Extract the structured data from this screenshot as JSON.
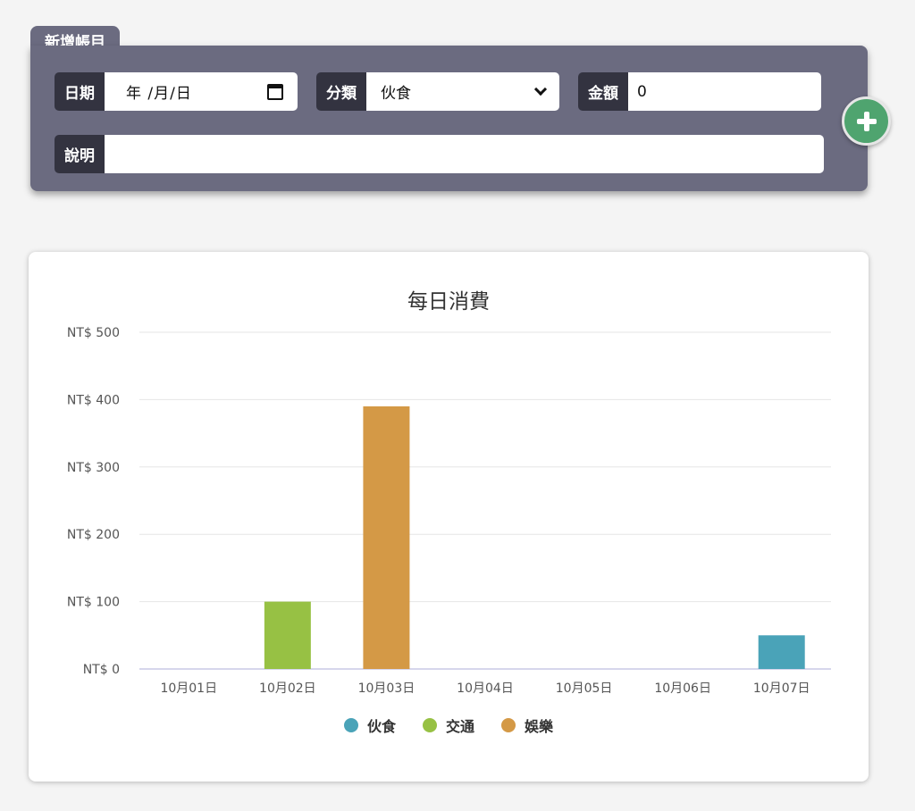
{
  "form": {
    "tab_title": "新增帳目",
    "date_label": "日期",
    "date_value": "年 /月/日",
    "category_label": "分類",
    "category_value": "伙食",
    "amount_label": "金額",
    "amount_value": "0",
    "description_label": "說明",
    "description_value": "",
    "add_icon": "plus-icon"
  },
  "colors": {
    "panel": "#6b6b80",
    "label_bg": "#333340",
    "add_button": "#4fa46f"
  },
  "chart_data": {
    "type": "bar",
    "title": "每日消費",
    "xlabel": "",
    "ylabel": "",
    "ylim": [
      0,
      500
    ],
    "yticks": [
      "NT$ 0",
      "NT$ 100",
      "NT$ 200",
      "NT$ 300",
      "NT$ 400",
      "NT$ 500"
    ],
    "ytick_values": [
      0,
      100,
      200,
      300,
      400,
      500
    ],
    "categories": [
      "10月01日",
      "10月02日",
      "10月03日",
      "10月04日",
      "10月05日",
      "10月06日",
      "10月07日"
    ],
    "series": [
      {
        "name": "伙食",
        "color": "#4aa3b8",
        "values": [
          0,
          0,
          0,
          0,
          0,
          0,
          50
        ]
      },
      {
        "name": "交通",
        "color": "#97c144",
        "values": [
          0,
          100,
          0,
          0,
          0,
          0,
          0
        ]
      },
      {
        "name": "娛樂",
        "color": "#d49946",
        "values": [
          0,
          0,
          390,
          0,
          0,
          0,
          0
        ]
      }
    ],
    "grid": true,
    "legend_position": "bottom"
  }
}
